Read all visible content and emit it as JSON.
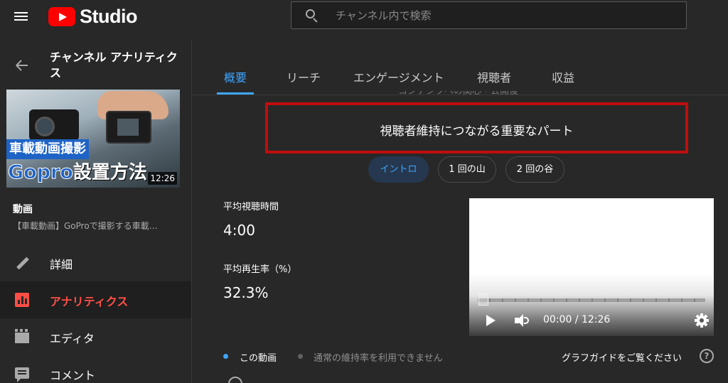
{
  "app": {
    "logo_text": "Studio",
    "brand_color": "#ff0000"
  },
  "search": {
    "placeholder": "チャンネル内で検索"
  },
  "sidebar": {
    "title": "チャンネル アナリティクス",
    "thumbnail": {
      "tag_text": "車載動画撮影",
      "main_text_latin": "Gopro",
      "main_text_jp": "設置方法",
      "duration": "12:26"
    },
    "video_section_label": "動画",
    "video_title": "【車載動画】GoProで撮影する車載…",
    "items": [
      {
        "label": "詳細",
        "icon": "pencil-icon",
        "active": false
      },
      {
        "label": "アナリティクス",
        "icon": "analytics-icon",
        "active": true
      },
      {
        "label": "エディタ",
        "icon": "clapperboard-icon",
        "active": false
      },
      {
        "label": "コメント",
        "icon": "comment-icon",
        "active": false
      }
    ]
  },
  "tabs": [
    {
      "label": "概要",
      "active": true
    },
    {
      "label": "リーチ",
      "active": false
    },
    {
      "label": "エンゲージメント",
      "active": false
    },
    {
      "label": "視聴者",
      "active": false
    },
    {
      "label": "収益",
      "active": false
    }
  ],
  "main": {
    "peek_text": "コンテンツへの関心・公開後",
    "section_title": "視聴者維持につながる重要なパート",
    "chips": [
      {
        "label": "イントロ",
        "active": true
      },
      {
        "label": "1 回の山",
        "active": false
      },
      {
        "label": "2 回の谷",
        "active": false
      }
    ],
    "metrics": [
      {
        "label": "平均視聴時間",
        "value": "4:00"
      },
      {
        "label": "平均再生率（%）",
        "value": "32.3%"
      }
    ],
    "player": {
      "time": "00:00 / 12:26"
    },
    "legend": [
      {
        "label": "この動画",
        "color": "#3ea6ff"
      },
      {
        "label": "通常の維持率を利用できません",
        "color": "#606060"
      }
    ],
    "guide_link": "グラフガイドをご覧ください",
    "help_icon_glyph": "?"
  },
  "colors": {
    "accent_blue": "#3ea6ff",
    "active_red": "#ff4e45",
    "highlight_border": "#c00d0d",
    "background": "#282828"
  }
}
